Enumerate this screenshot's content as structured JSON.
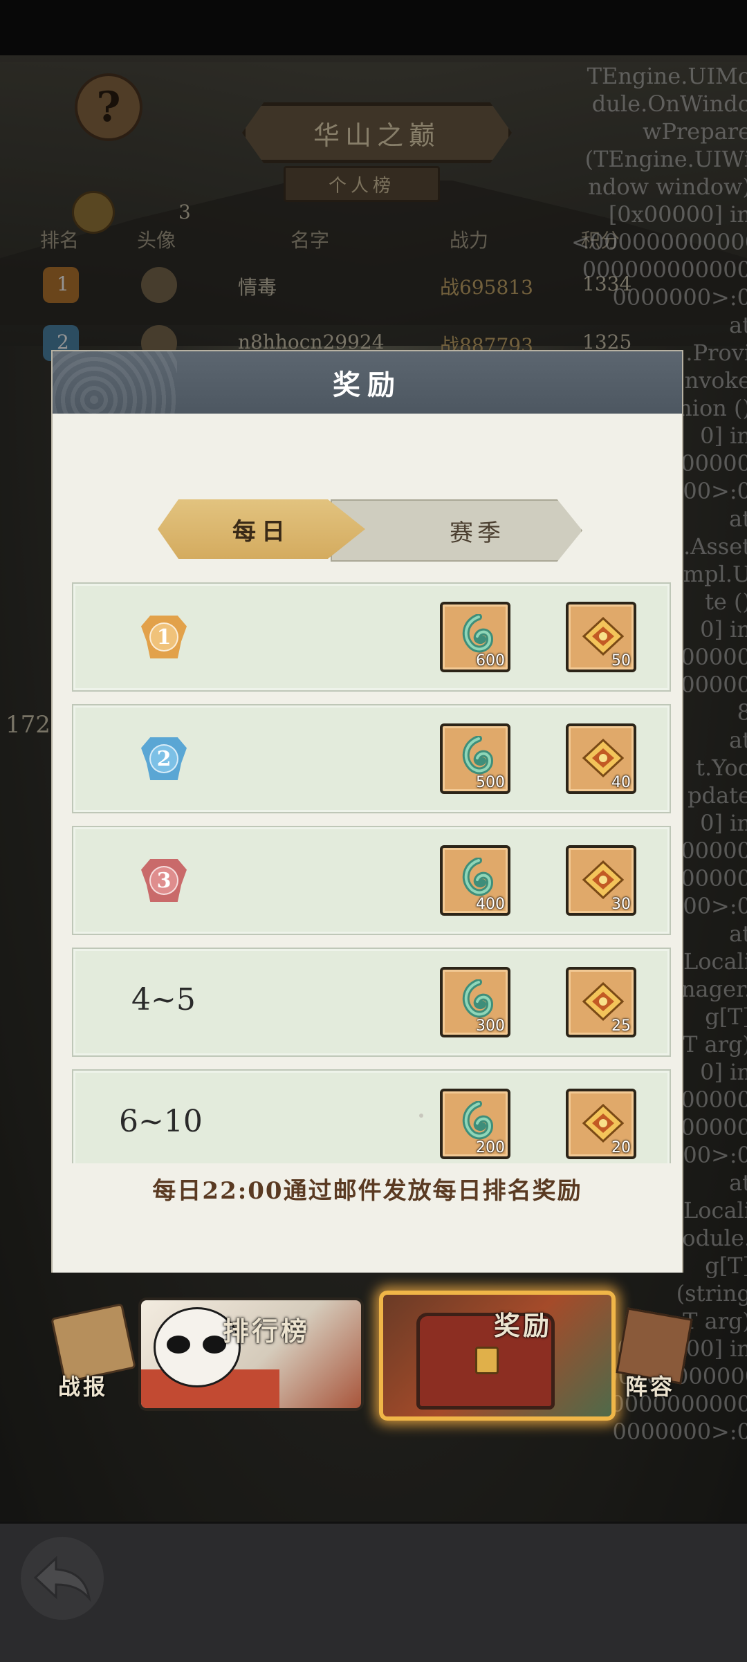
{
  "background": {
    "title": "华山之巅",
    "subtitle": "个人榜",
    "avatar_count": "3",
    "columns": [
      "排名",
      "头像",
      "名字",
      "战力",
      "积分"
    ],
    "rows": [
      {
        "rank": "1",
        "name": "情毒",
        "power": "战695813",
        "score": "1334"
      },
      {
        "rank": "2",
        "name": "n8hhocn29924",
        "power": "战887793",
        "score": "1325"
      }
    ],
    "left_number": "172",
    "debug_log": "TEngine.UIMo\ndule.OnWindo\nwPrepare\n(TEngine.UIWi\nndow window)\n[0x00000] in\n<000000000000\n000000000000\n0000000>:0\nat\n.Provi\nnvoke\nnion ()\n0] in\n000000\n00>:0\nat\n.Asset\nmpl.U\nte ()\n0] in\n000000\n000000\n8\nat\nt.Yoo\npdate\n0] in\n000000\n000000\n00>:0\nat\nLocali\nnager.\ng[T]\nT arg)\n0] in\n000000\n000000\n00>:0\nat\nEngine.Locali\nnModule.\ng[T]\n(string\nkey, T arg)\n[0x00000] in\n<000000000000\n000000000000\n0000000>:0"
  },
  "dialog": {
    "title": "奖励",
    "tabs": {
      "daily": "每日",
      "season": "赛季",
      "active": "daily"
    },
    "rewards": [
      {
        "rank": "1",
        "medal": "gold",
        "jade": "600",
        "treasure": "50"
      },
      {
        "rank": "2",
        "medal": "blue",
        "jade": "500",
        "treasure": "40"
      },
      {
        "rank": "3",
        "medal": "red",
        "jade": "400",
        "treasure": "30"
      },
      {
        "rank": "4~5",
        "medal": null,
        "jade": "300",
        "treasure": "25"
      },
      {
        "rank": "6~10",
        "medal": null,
        "jade": "200",
        "treasure": "20"
      }
    ],
    "note": "每日22:00通过邮件发放每日排名奖励"
  },
  "bottom_nav": {
    "battle_report": "战报",
    "leaderboard": "排行榜",
    "rewards": "奖励",
    "lineup": "阵容",
    "active": "rewards"
  },
  "colors": {
    "medal_gold": "#e2a14a",
    "medal_blue": "#5aa6d4",
    "medal_red": "#c96a6a",
    "tab_active": "#d9b467",
    "header_bar": "#56606a",
    "reward_glow": "#f0b648"
  }
}
